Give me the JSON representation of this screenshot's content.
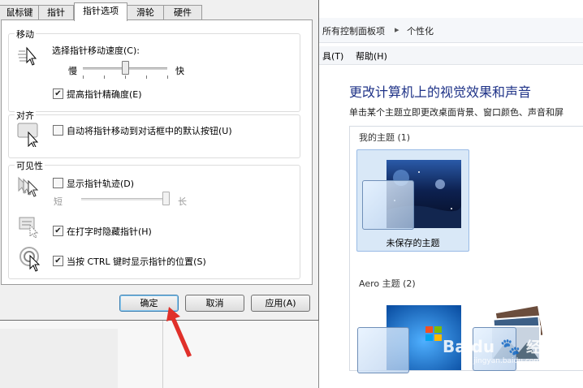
{
  "dialog": {
    "tabs": [
      {
        "label": "鼠标键",
        "active": false
      },
      {
        "label": "指针",
        "active": false
      },
      {
        "label": "指针选项",
        "active": true
      },
      {
        "label": "滑轮",
        "active": false
      },
      {
        "label": "硬件",
        "active": false
      }
    ],
    "motion": {
      "group_title": "移动",
      "speed_label": "选择指针移动速度(C):",
      "slow": "慢",
      "fast": "快",
      "speed_level": 0.5,
      "precision_label": "提高指针精确度(E)",
      "precision_checked": true
    },
    "snap": {
      "group_title": "对齐",
      "snap_label": "自动将指针移动到对话框中的默认按钮(U)",
      "snap_checked": false
    },
    "visibility": {
      "group_title": "可见性",
      "trails_label": "显示指针轨迹(D)",
      "trails_checked": false,
      "short": "短",
      "long": "长",
      "trail_level": 1.0,
      "hide_label": "在打字时隐藏指针(H)",
      "hide_checked": true,
      "ctrl_label": "当按 CTRL 键时显示指针的位置(S)",
      "ctrl_checked": true
    },
    "buttons": {
      "ok": "确定",
      "cancel": "取消",
      "apply": "应用(A)"
    }
  },
  "control_panel": {
    "breadcrumb": [
      "所有控制面板项",
      "个性化"
    ],
    "breadcrumb_sep": "▸",
    "menu": [
      "具(T)",
      "帮助(H)"
    ],
    "title": "更改计算机上的视觉效果和声音",
    "subtitle": "单击某个主题立即更改桌面背景、窗口颜色、声音和屏",
    "my_themes": "我的主题 (1)",
    "unsaved_theme": "未保存的主题",
    "aero_themes": "Aero 主题 (2)"
  },
  "watermark": {
    "brand": "Baidu",
    "sub": "经验",
    "site": "jingyan.baidu.com"
  },
  "colors": {
    "accent": "#1e3287",
    "arrow": "#e0302a",
    "selection": "#d9e8f7"
  }
}
